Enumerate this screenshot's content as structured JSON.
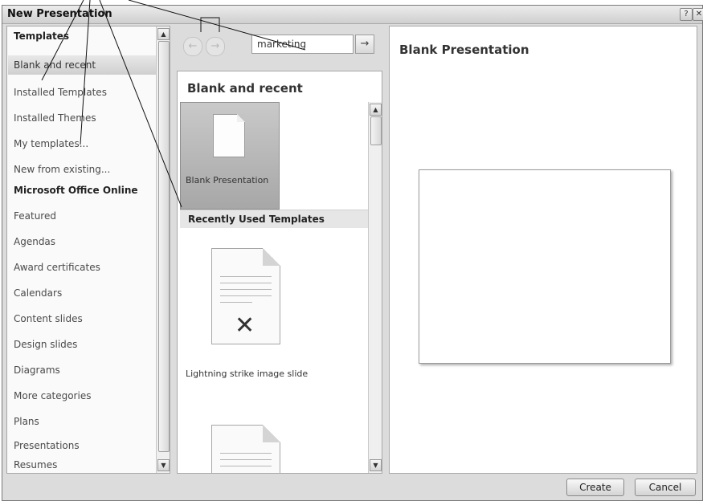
{
  "dialog": {
    "title": "New Presentation",
    "help_glyph": "?",
    "close_glyph": "✕"
  },
  "sidebar": {
    "items": [
      {
        "label": "Templates",
        "header": true
      },
      {
        "label": "Blank and recent",
        "selected": true
      },
      {
        "label": "Installed Templates"
      },
      {
        "label": "Installed Themes"
      },
      {
        "label": "My templates..."
      },
      {
        "label": "New from existing..."
      },
      {
        "label": "Microsoft Office Online",
        "header": true
      },
      {
        "label": "Featured"
      },
      {
        "label": "Agendas"
      },
      {
        "label": "Award certificates"
      },
      {
        "label": "Calendars"
      },
      {
        "label": "Content slides"
      },
      {
        "label": "Design slides"
      },
      {
        "label": "Diagrams"
      },
      {
        "label": "More categories"
      },
      {
        "label": "Plans"
      },
      {
        "label": "Presentations"
      },
      {
        "label": "Resumes"
      }
    ]
  },
  "search": {
    "value": "marketing",
    "back_glyph": "←",
    "forward_glyph": "→",
    "go_glyph": "→"
  },
  "middle": {
    "title": "Blank and recent",
    "blank_label": "Blank Presentation",
    "recent_header": "Recently Used Templates",
    "recent_items": [
      {
        "label": "Lightning strike image slide"
      }
    ]
  },
  "preview": {
    "title": "Blank Presentation"
  },
  "buttons": {
    "create": "Create",
    "cancel": "Cancel"
  }
}
